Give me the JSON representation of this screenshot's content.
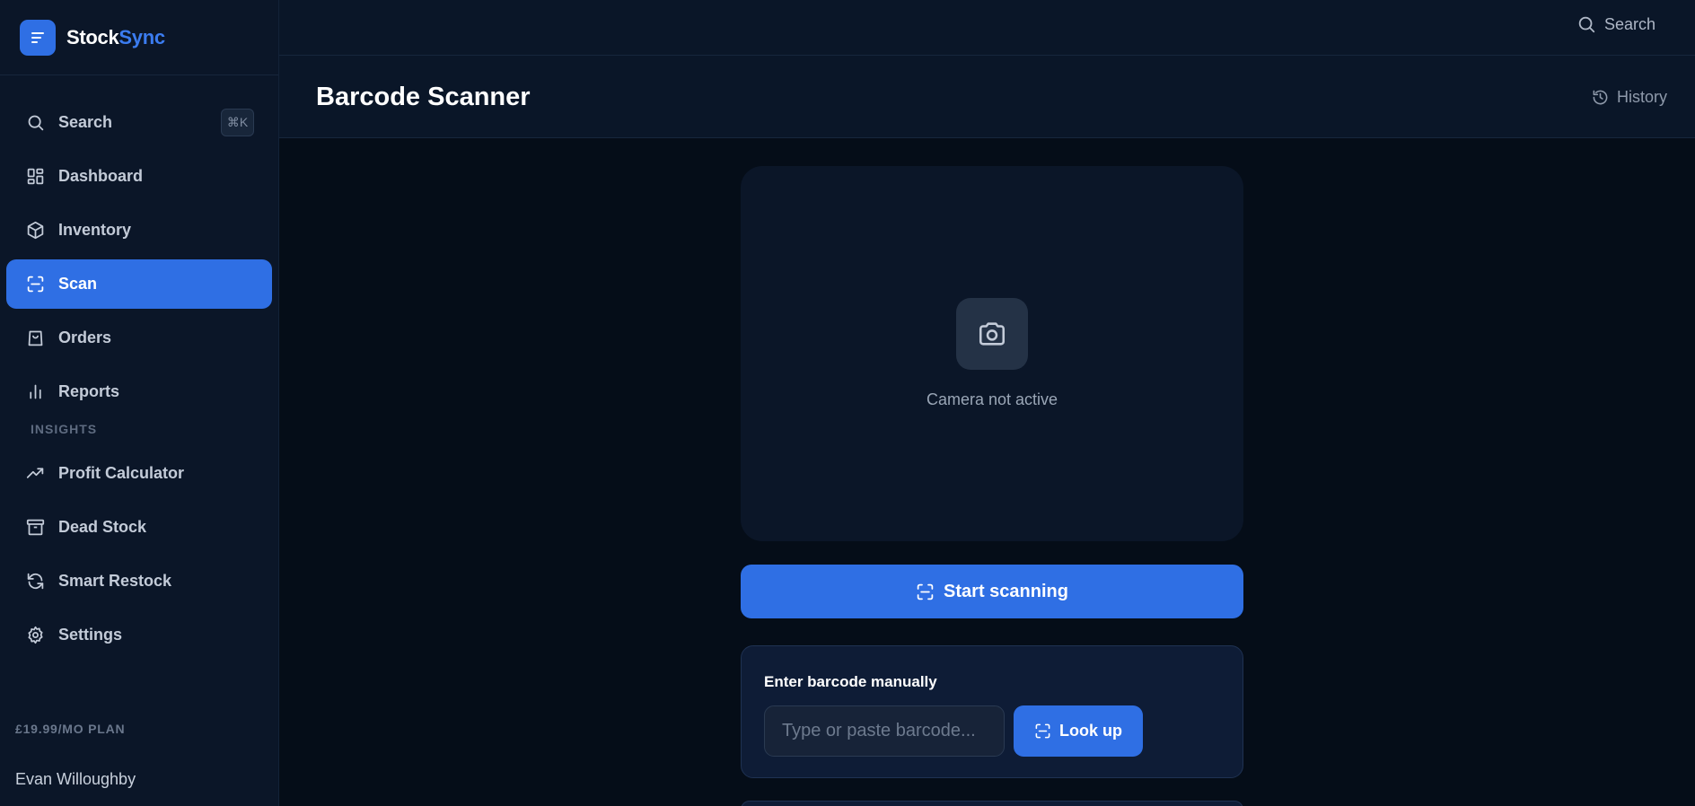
{
  "brand": {
    "name_part1": "Stock",
    "name_part2": "Sync",
    "logo_icon": "menu-lines-icon"
  },
  "sidebar": {
    "search": {
      "label": "Search",
      "shortcut": "⌘K",
      "icon": "search-icon"
    },
    "items": [
      {
        "label": "Dashboard",
        "icon": "dashboard-icon",
        "active": false
      },
      {
        "label": "Inventory",
        "icon": "box-icon",
        "active": false
      },
      {
        "label": "Scan",
        "icon": "scan-icon",
        "active": true
      },
      {
        "label": "Orders",
        "icon": "shopping-bag-icon",
        "active": false
      },
      {
        "label": "Reports",
        "icon": "bar-chart-icon",
        "active": false
      }
    ],
    "insights_label": "INSIGHTS",
    "insights": [
      {
        "label": "Profit Calculator",
        "icon": "trending-up-icon"
      },
      {
        "label": "Dead Stock",
        "icon": "archive-icon"
      },
      {
        "label": "Smart Restock",
        "icon": "refresh-icon"
      },
      {
        "label": "Settings",
        "icon": "gear-icon"
      }
    ],
    "plan": "£19.99/MO PLAN",
    "user": "Evan Willoughby"
  },
  "topbar": {
    "search_label": "Search"
  },
  "page": {
    "title": "Barcode Scanner",
    "history_label": "History"
  },
  "camera": {
    "status": "Camera not active",
    "icon": "camera-icon"
  },
  "start_button": {
    "label": "Start scanning"
  },
  "manual": {
    "title": "Enter barcode manually",
    "input_placeholder": "Type or paste barcode...",
    "input_value": "",
    "lookup_label": "Look up"
  },
  "colors": {
    "accent": "#2f6fe4",
    "background": "#050d18",
    "sidebar": "#0b1628"
  }
}
